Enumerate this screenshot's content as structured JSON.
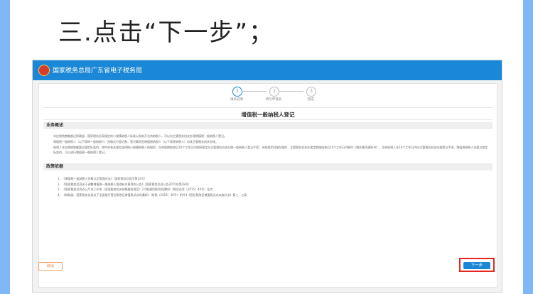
{
  "heading": "三.点击“下一步”；",
  "topbar": {
    "title": "国家税务总局广东省电子税务局"
  },
  "steps": [
    {
      "num": "1",
      "label": "填表说明",
      "active": true
    },
    {
      "num": "2",
      "label": "填写申请表",
      "active": false
    },
    {
      "num": "3",
      "label": "完成",
      "active": false
    }
  ],
  "form_title": "增值税一般纳税人登记",
  "sections": {
    "overview_title": "业务概述",
    "overview_text": [
      "年应税销售额超过财政部、国家税务总局规定的小规模纳税人标准以及新开业的纳税人，可以向主管税务机关办理增值税一般纳税人登记。",
      "增值税一般纳税人（以下简称一般纳税人）资格实行登记制，登记事项由增值税纳税人（以下简称纳税人）向其主管税务机关办理。",
      "纳税人年应税销售额超过规定标准的，除符合有关规定选择按小规模纳税人纳税的，在申报期结束后20个工作日内按照规定向主管税务机关办理一般纳税人登记手续；未按规定时限办理的，主管税务机关在规定期限结束后10个工作日内制作《税务事项通知书》，告知纳税人在10个工作日内向主管税务机关办理登记手续。增值税纳税人未超过规定标准的，可以进行增值税一般纳税人登记。"
    ],
    "policy_title": "政策依据",
    "policy_items": [
      "1、《增值税一般纳税人资格认定管理办法》（国家税务总局令第22号）",
      "2、《国家税务总局关于调整增值税一般纳税人管理有关事项的公告》（国家税务总局公告2015年第18号）",
      "3、《国家税务总局办公厅关于印发〈全国税务机关纳税服务规范〉2.0版通用事项的通知》（税总办发〔2015〕40号）全文",
      "4、《财政部、国家税务总局关于全面推开营业税改征增值税试点的通知》（财税〔2016〕36号）附件1《营业税改征增值税试点实施办法》第三、五条"
    ]
  },
  "buttons": {
    "back": "取消",
    "next": "下一步"
  },
  "colors": {
    "brand_blue": "#1a88d6",
    "highlight_red": "#e5251f",
    "page_bg": "#7fb8f5"
  }
}
